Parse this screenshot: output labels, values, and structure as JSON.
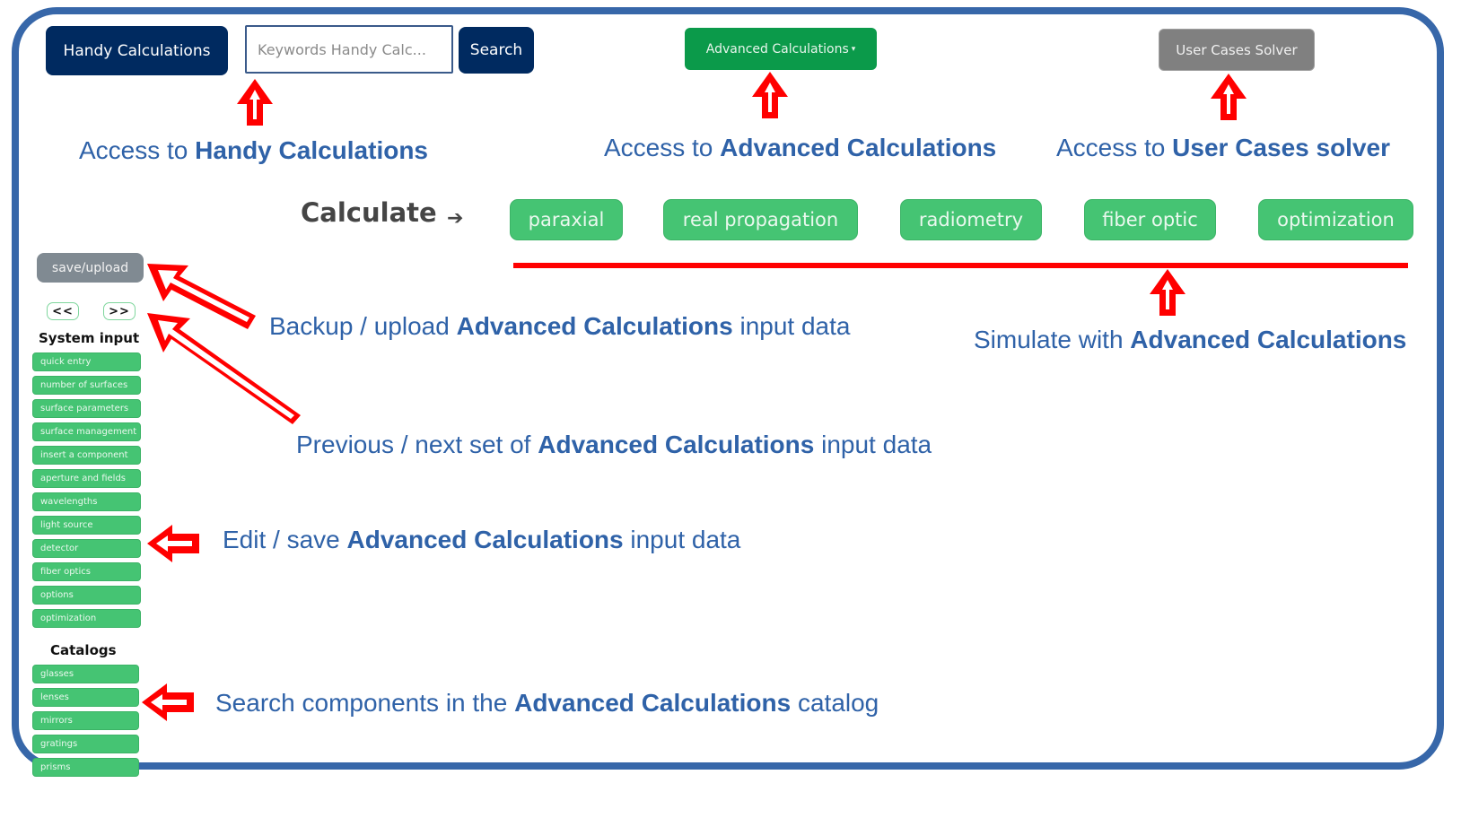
{
  "header": {
    "handy_button": "Handy Calculations",
    "search_placeholder": "Keywords Handy Calc...",
    "search_button": "Search",
    "advanced_dropdown": "Advanced Calculations",
    "advanced_caret": "▾",
    "user_cases_button": "User Cases Solver"
  },
  "calculate": {
    "label": "Calculate",
    "arrow": "➔",
    "buttons": [
      "paraxial",
      "real propagation",
      "radiometry",
      "fiber optic",
      "optimization"
    ]
  },
  "sidebar": {
    "save_upload": "save/upload",
    "prev": "<<",
    "next": ">>",
    "system_input_title": "System input",
    "system_input_items": [
      "quick entry",
      "number of surfaces",
      "surface parameters",
      "surface management",
      "insert a component",
      "aperture and fields",
      "wavelengths",
      "light source",
      "detector",
      "fiber optics",
      "options",
      "optimization"
    ],
    "catalogs_title": "Catalogs",
    "catalog_items": [
      "glasses",
      "lenses",
      "mirrors",
      "gratings",
      "prisms"
    ]
  },
  "annotations": {
    "handy": {
      "pre": "Access to ",
      "bold": "Handy Calculations",
      "post": ""
    },
    "advanced": {
      "pre": "Access to ",
      "bold": "Advanced Calculations",
      "post": ""
    },
    "user_cases": {
      "pre": "Access to ",
      "bold": "User Cases solver",
      "post": ""
    },
    "simulate": {
      "pre": "Simulate with  ",
      "bold": "Advanced Calculations",
      "post": ""
    },
    "backup": {
      "pre": "Backup / upload  ",
      "bold": "Advanced Calculations",
      "post": " input data"
    },
    "prev_next": {
      "pre": "Previous / next set of  ",
      "bold": "Advanced Calculations",
      "post": " input data"
    },
    "edit_save": {
      "pre": "Edit / save  ",
      "bold": "Advanced Calculations",
      "post": " input data"
    },
    "search_catalog": {
      "pre": "Search components in the  ",
      "bold": "Advanced Calculations",
      "post": " catalog"
    }
  },
  "colors": {
    "frame": "#3767a9",
    "navy": "#002a60",
    "green": "#45c473",
    "dropdown_green": "#0b9a4a",
    "gray": "#808080",
    "annotation_text": "#2f62a8",
    "arrow_red": "#ff0000"
  }
}
